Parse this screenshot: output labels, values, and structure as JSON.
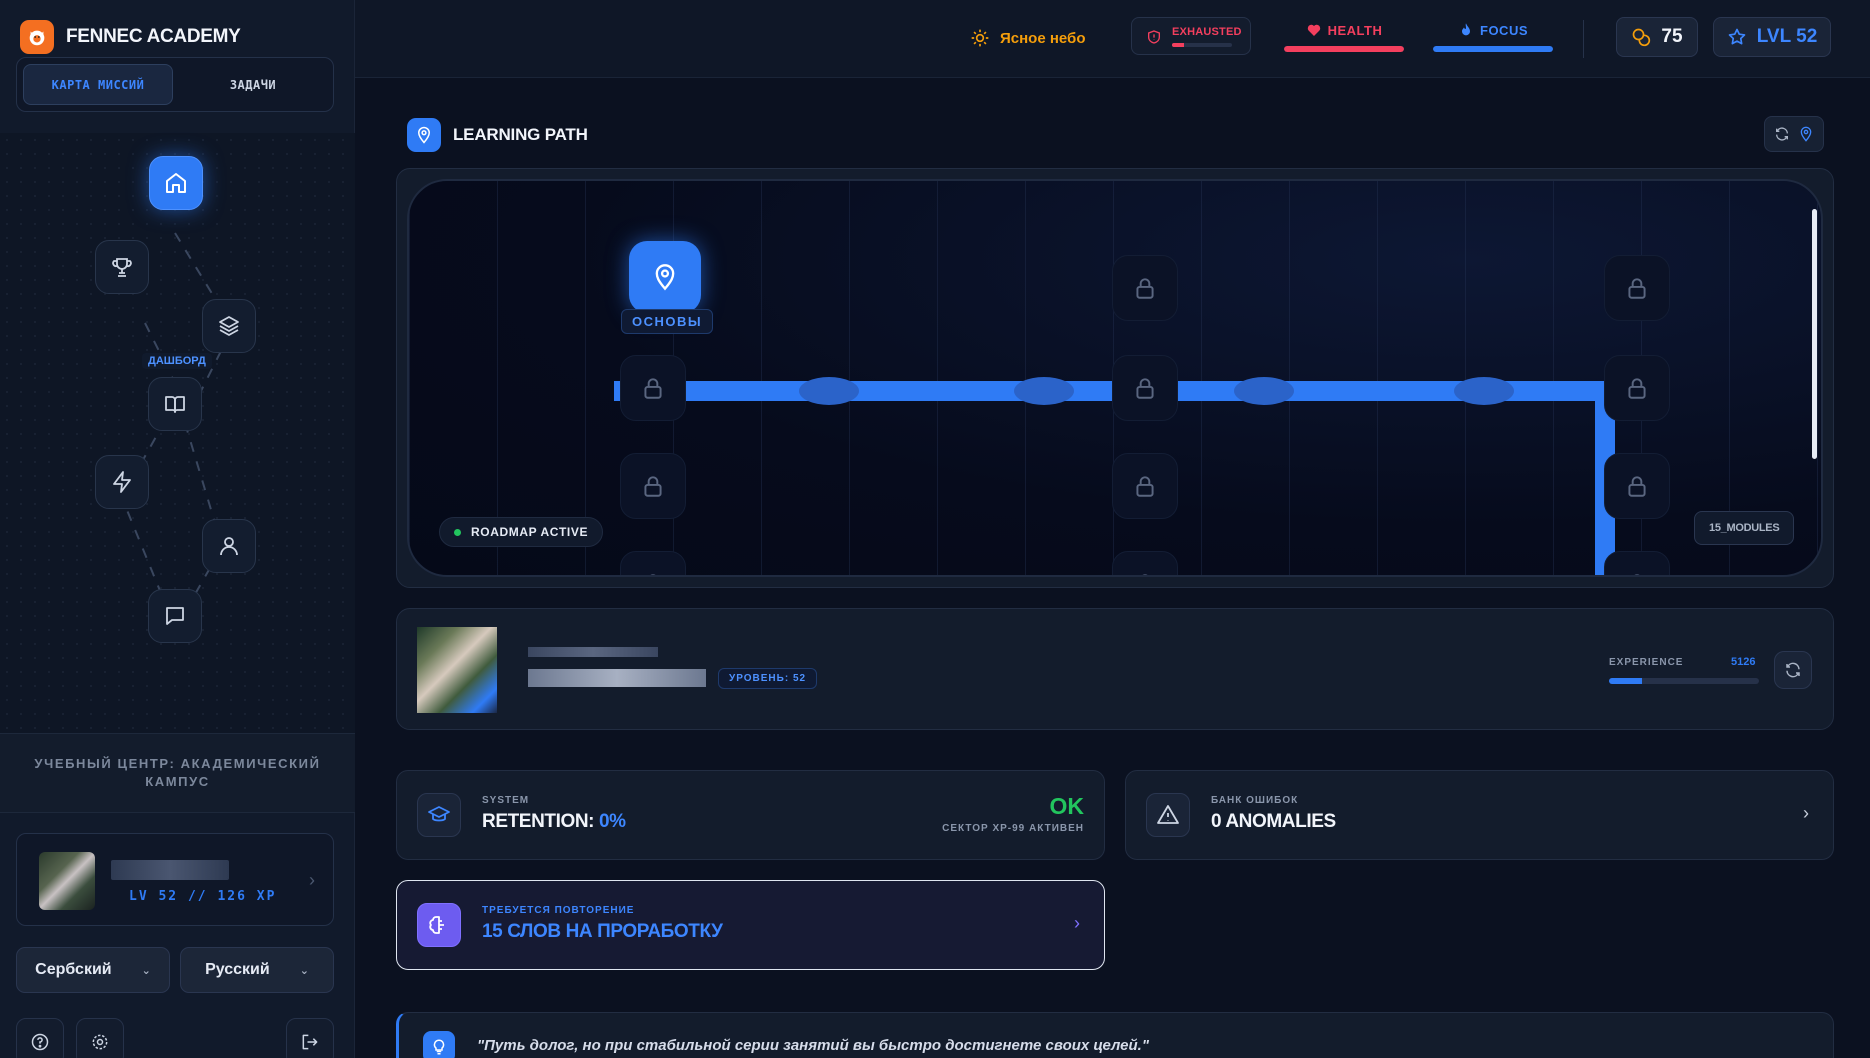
{
  "brand": {
    "name": "FENNEC ACADEMY"
  },
  "mode_tabs": [
    {
      "label": "КАРТА МИССИЙ",
      "active": true
    },
    {
      "label": "ЗАДАЧИ",
      "active": false
    }
  ],
  "nav": {
    "active_label": "ДАШБОРД",
    "nodes": [
      "home-icon",
      "trophy-icon",
      "layers-icon",
      "book-icon",
      "lightning-icon",
      "user-icon",
      "chat-icon"
    ]
  },
  "campus": {
    "label": "УЧЕБНЫЙ ЦЕНТР: АКАДЕМИЧЕСКИЙ КАМПУС"
  },
  "user_card": {
    "level_xp": "LV 52 // 126 XP"
  },
  "languages": {
    "source": "Сербский",
    "target": "Русский"
  },
  "header": {
    "weather": "Ясное небо",
    "status": {
      "label": "EXHAUSTED",
      "level": 0.2
    },
    "health": {
      "label": "HEALTH",
      "level": 1.0
    },
    "focus": {
      "label": "FOCUS",
      "level": 1.0
    },
    "coins": "75",
    "level": "LVL 52"
  },
  "learning_path": {
    "title": "LEARNING PATH",
    "start_label": "ОСНОВЫ",
    "roadmap_status": "ROADMAP ACTIVE",
    "modules_badge": "15_MODULES"
  },
  "profile": {
    "level_badge": "УРОВЕНЬ: 52",
    "experience_label": "EXPERIENCE",
    "experience_value": "5126",
    "experience_progress": 0.22
  },
  "cards": {
    "retention": {
      "small": "SYSTEM",
      "big_prefix": "RETENTION: ",
      "big_value": "0%",
      "status": "OK",
      "status_sub": "СЕКТОР XP-99 АКТИВЕН"
    },
    "errors": {
      "small": "БАНК ОШИБОК",
      "big": "0 ANOMALIES"
    },
    "review": {
      "small": "ТРЕБУЕТСЯ ПОВТОРЕНИЕ",
      "big": "15 СЛОВ НА ПРОРАБОТКУ"
    }
  },
  "quote": {
    "text": "\"Путь долог, но при стабильной серии занятий вы быстро достигнете своих целей.\""
  },
  "colors": {
    "accent": "#2f7bf5",
    "danger": "#f43f5e",
    "success": "#22c55e",
    "warning": "#f59e0b",
    "brand": "#f46f21"
  }
}
